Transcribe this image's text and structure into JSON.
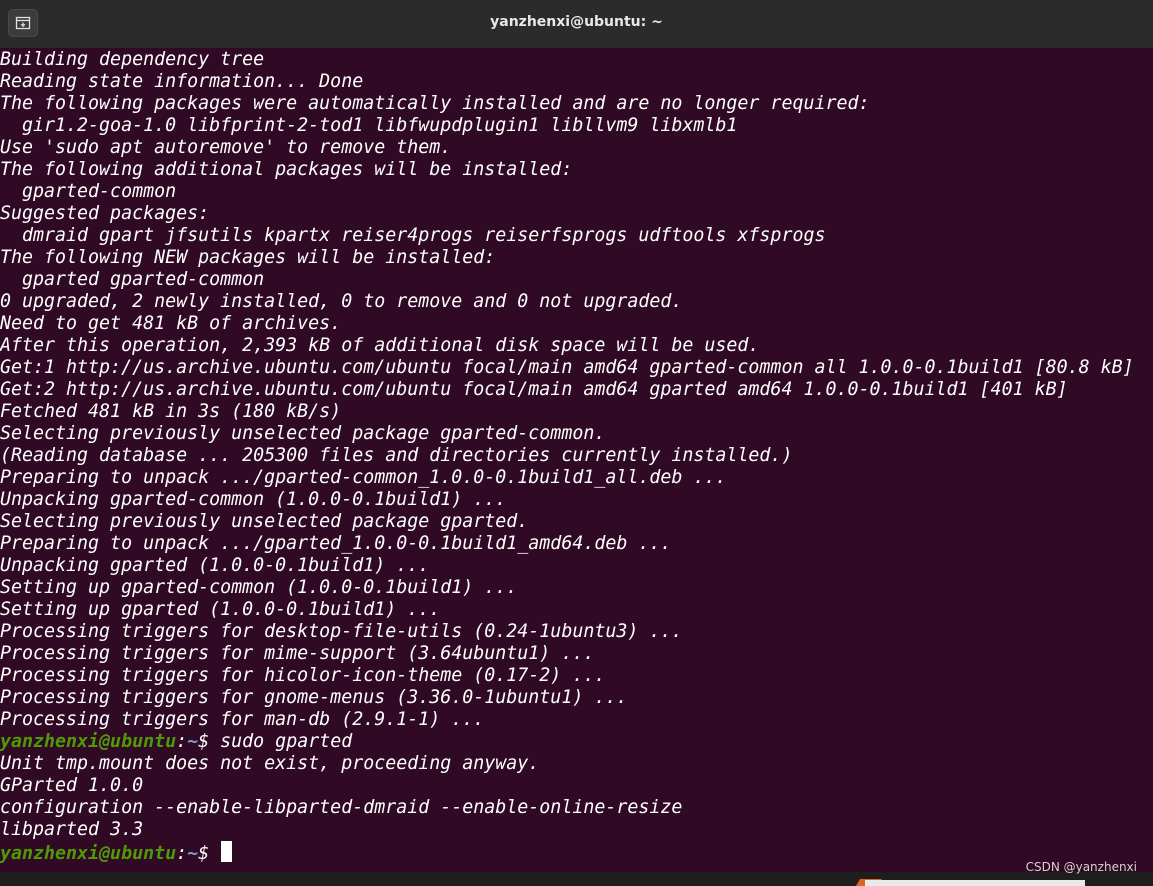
{
  "window": {
    "title": "yanzhenxi@ubuntu: ~",
    "newtab_icon": "new-tab-icon"
  },
  "terminal": {
    "lines": [
      "Building dependency tree",
      "Reading state information... Done",
      "The following packages were automatically installed and are no longer required:",
      "  gir1.2-goa-1.0 libfprint-2-tod1 libfwupdplugin1 libllvm9 libxmlb1",
      "Use 'sudo apt autoremove' to remove them.",
      "The following additional packages will be installed:",
      "  gparted-common",
      "Suggested packages:",
      "  dmraid gpart jfsutils kpartx reiser4progs reiserfsprogs udftools xfsprogs",
      "The following NEW packages will be installed:",
      "  gparted gparted-common",
      "0 upgraded, 2 newly installed, 0 to remove and 0 not upgraded.",
      "Need to get 481 kB of archives.",
      "After this operation, 2,393 kB of additional disk space will be used.",
      "Get:1 http://us.archive.ubuntu.com/ubuntu focal/main amd64 gparted-common all 1.0.0-0.1build1 [80.8 kB]",
      "Get:2 http://us.archive.ubuntu.com/ubuntu focal/main amd64 gparted amd64 1.0.0-0.1build1 [401 kB]",
      "Fetched 481 kB in 3s (180 kB/s)",
      "Selecting previously unselected package gparted-common.",
      "(Reading database ... 205300 files and directories currently installed.)",
      "Preparing to unpack .../gparted-common_1.0.0-0.1build1_all.deb ...",
      "Unpacking gparted-common (1.0.0-0.1build1) ...",
      "Selecting previously unselected package gparted.",
      "Preparing to unpack .../gparted_1.0.0-0.1build1_amd64.deb ...",
      "Unpacking gparted (1.0.0-0.1build1) ...",
      "Setting up gparted-common (1.0.0-0.1build1) ...",
      "Setting up gparted (1.0.0-0.1build1) ...",
      "Processing triggers for desktop-file-utils (0.24-1ubuntu3) ...",
      "Processing triggers for mime-support (3.64ubuntu1) ...",
      "Processing triggers for hicolor-icon-theme (0.17-2) ...",
      "Processing triggers for gnome-menus (3.36.0-1ubuntu1) ...",
      "Processing triggers for man-db (2.9.1-1) ..."
    ],
    "prompt1": {
      "user_host": "yanzhenxi@ubuntu",
      "colon": ":",
      "path": "~",
      "symbol": "$ ",
      "command": "sudo gparted"
    },
    "output2": [
      "Unit tmp.mount does not exist, proceeding anyway.",
      "GParted 1.0.0",
      "configuration --enable-libparted-dmraid --enable-online-resize",
      "libparted 3.3"
    ],
    "prompt2": {
      "user_host": "yanzhenxi@ubuntu",
      "colon": ":",
      "path": "~",
      "symbol": "$ ",
      "command": ""
    }
  },
  "watermark": "CSDN @yanzhenxi",
  "colors": {
    "terminal_bg": "#300a24",
    "titlebar_bg": "#2b2b2b",
    "prompt_user": "#4e9a06",
    "prompt_path": "#729fcf",
    "text": "#ffffff"
  }
}
